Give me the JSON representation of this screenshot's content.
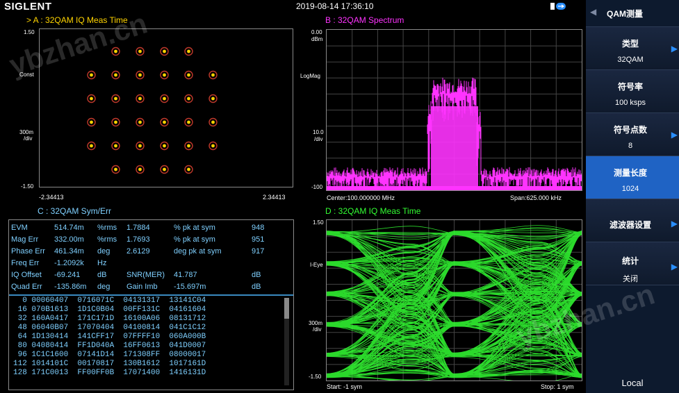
{
  "status": {
    "brand": "SIGLENT",
    "datetime": "2019-08-14 17:36:10"
  },
  "traceA": {
    "title": "> A :  32QAM  IQ Meas Time",
    "y_top": "1.50",
    "y_mid": "Const",
    "y_div1": "300m",
    "y_div2": "/div",
    "y_bot": "-1.50",
    "x_left": "-2.34413",
    "x_right": "2.34413"
  },
  "traceB": {
    "title": "B :  32QAM  Spectrum",
    "y_top": "0.00",
    "y_unit": "dBm",
    "y_mode": "LogMag",
    "y_div1": "10.0",
    "y_div2": "/div",
    "y_bot": "-100",
    "center": "Center:100.000000 MHz",
    "span": "Span:625.000 kHz"
  },
  "traceC": {
    "title": "C :  32QAM  Sym/Err",
    "meas": [
      [
        "EVM",
        "514.74m",
        "%rms",
        "1.7884",
        "%  pk at sym",
        "948"
      ],
      [
        "Mag Err",
        "332.00m",
        "%rms",
        "1.7693",
        "%  pk at sym",
        "951"
      ],
      [
        "Phase Err",
        "461.34m",
        "deg",
        "2.6129",
        "deg  pk at sym",
        "917"
      ],
      [
        "Freq Err",
        "-1.2092k",
        "Hz",
        "",
        "",
        ""
      ],
      [
        "IQ Offset",
        "-69.241",
        "dB",
        "SNR(MER)",
        "41.787",
        "dB"
      ],
      [
        "Quad Err",
        "-135.86m",
        "deg",
        "Gain Imb",
        "-15.697m",
        "dB"
      ]
    ],
    "symbols": [
      "  0 00060407  0716071C  04131317  13141C04",
      " 16 070B1613  1D1C0B04  00FF131C  04161604",
      " 32 160A0417  171C171D  16100A06  08131712",
      " 48 06040B07  17070404  04100814  041C1C12",
      " 64 1D130414  141CFF17  07FFFF10  060A000B",
      " 80 04080414  FF1D040A  16FF0613  041D0007",
      " 96 1C1C1600  07141D14  171308FF  08000017",
      "112 1014101C  00170817  130B1612  1017161D",
      "128 171C0013  FF00FF0B  17071400  1416131D"
    ]
  },
  "traceD": {
    "title": "D :  32QAM  IQ Meas Time",
    "y_top": "1.50",
    "y_mode": "I-Eye",
    "y_div1": "300m",
    "y_div2": "/div",
    "y_bot": "-1.50",
    "start": "Start: -1 sym",
    "stop": "Stop: 1 sym"
  },
  "softkeys": {
    "menu_title": "QAM测量",
    "items": [
      {
        "label": "类型",
        "value": "32QAM"
      },
      {
        "label": "符号率",
        "value": "100 ksps"
      },
      {
        "label": "符号点数",
        "value": "8"
      },
      {
        "label": "测量长度",
        "value": "1024"
      },
      {
        "label": "滤波器设置",
        "value": ""
      },
      {
        "label": "统计",
        "value": "关闭"
      }
    ],
    "local": "Local"
  },
  "watermark": "ybzhan.cn",
  "colors": {
    "traceA": "#ffd400",
    "traceB": "#ff33ff",
    "traceC": "#7fd0ff",
    "traceD": "#33ff33",
    "active_key": "#1f63c4"
  }
}
